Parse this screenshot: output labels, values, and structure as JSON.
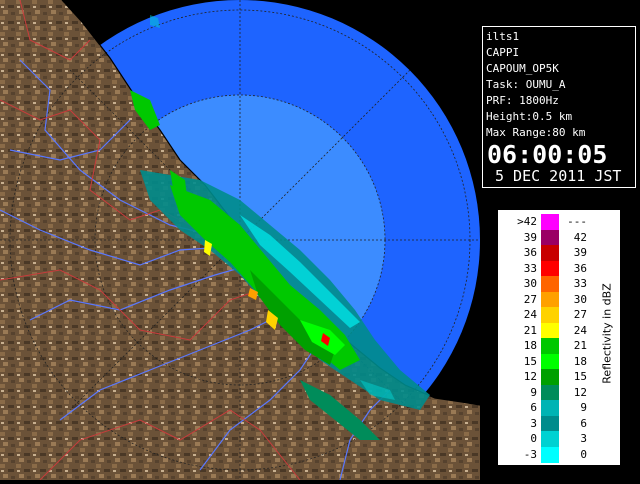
{
  "info": {
    "station": "ilts1",
    "product": "CAPPI",
    "product_name": "CAPOUM_OP5K",
    "task": "Task: OUMU_A",
    "prf": "PRF: 1800Hz",
    "height": "Height:0.5 km",
    "max_range": "Max Range:80 km",
    "time": "06:00:05",
    "date": "5 DEC 2011 JST"
  },
  "legend": {
    "unit_label": "Reflectivity in dBZ",
    "rows": [
      {
        "lo": ">42",
        "hi": "---",
        "color": "#ff00ff"
      },
      {
        "lo": "39",
        "hi": "42",
        "color": "#9a0064"
      },
      {
        "lo": "36",
        "hi": "39",
        "color": "#c80000"
      },
      {
        "lo": "33",
        "hi": "36",
        "color": "#ff0000"
      },
      {
        "lo": "30",
        "hi": "33",
        "color": "#ff6400"
      },
      {
        "lo": "27",
        "hi": "30",
        "color": "#ffa000"
      },
      {
        "lo": "24",
        "hi": "27",
        "color": "#ffd200"
      },
      {
        "lo": "21",
        "hi": "24",
        "color": "#ffff00"
      },
      {
        "lo": "18",
        "hi": "21",
        "color": "#00c800"
      },
      {
        "lo": "15",
        "hi": "18",
        "color": "#00ff00"
      },
      {
        "lo": "12",
        "hi": "15",
        "color": "#00a000"
      },
      {
        "lo": "9",
        "hi": "12",
        "color": "#008c5a"
      },
      {
        "lo": "6",
        "hi": "9",
        "color": "#00b4b4"
      },
      {
        "lo": "3",
        "hi": "6",
        "color": "#008c8c"
      },
      {
        "lo": "0",
        "hi": "3",
        "color": "#00d2d2"
      },
      {
        "lo": "-3",
        "hi": "0",
        "color": "#00ffff"
      }
    ]
  },
  "colors": {
    "sea_outer": "#1e64ff",
    "sea_inner": "#3c8cff",
    "land": "#6b5238",
    "rivers": "#5a78ff",
    "borders": "#c83c3c"
  }
}
